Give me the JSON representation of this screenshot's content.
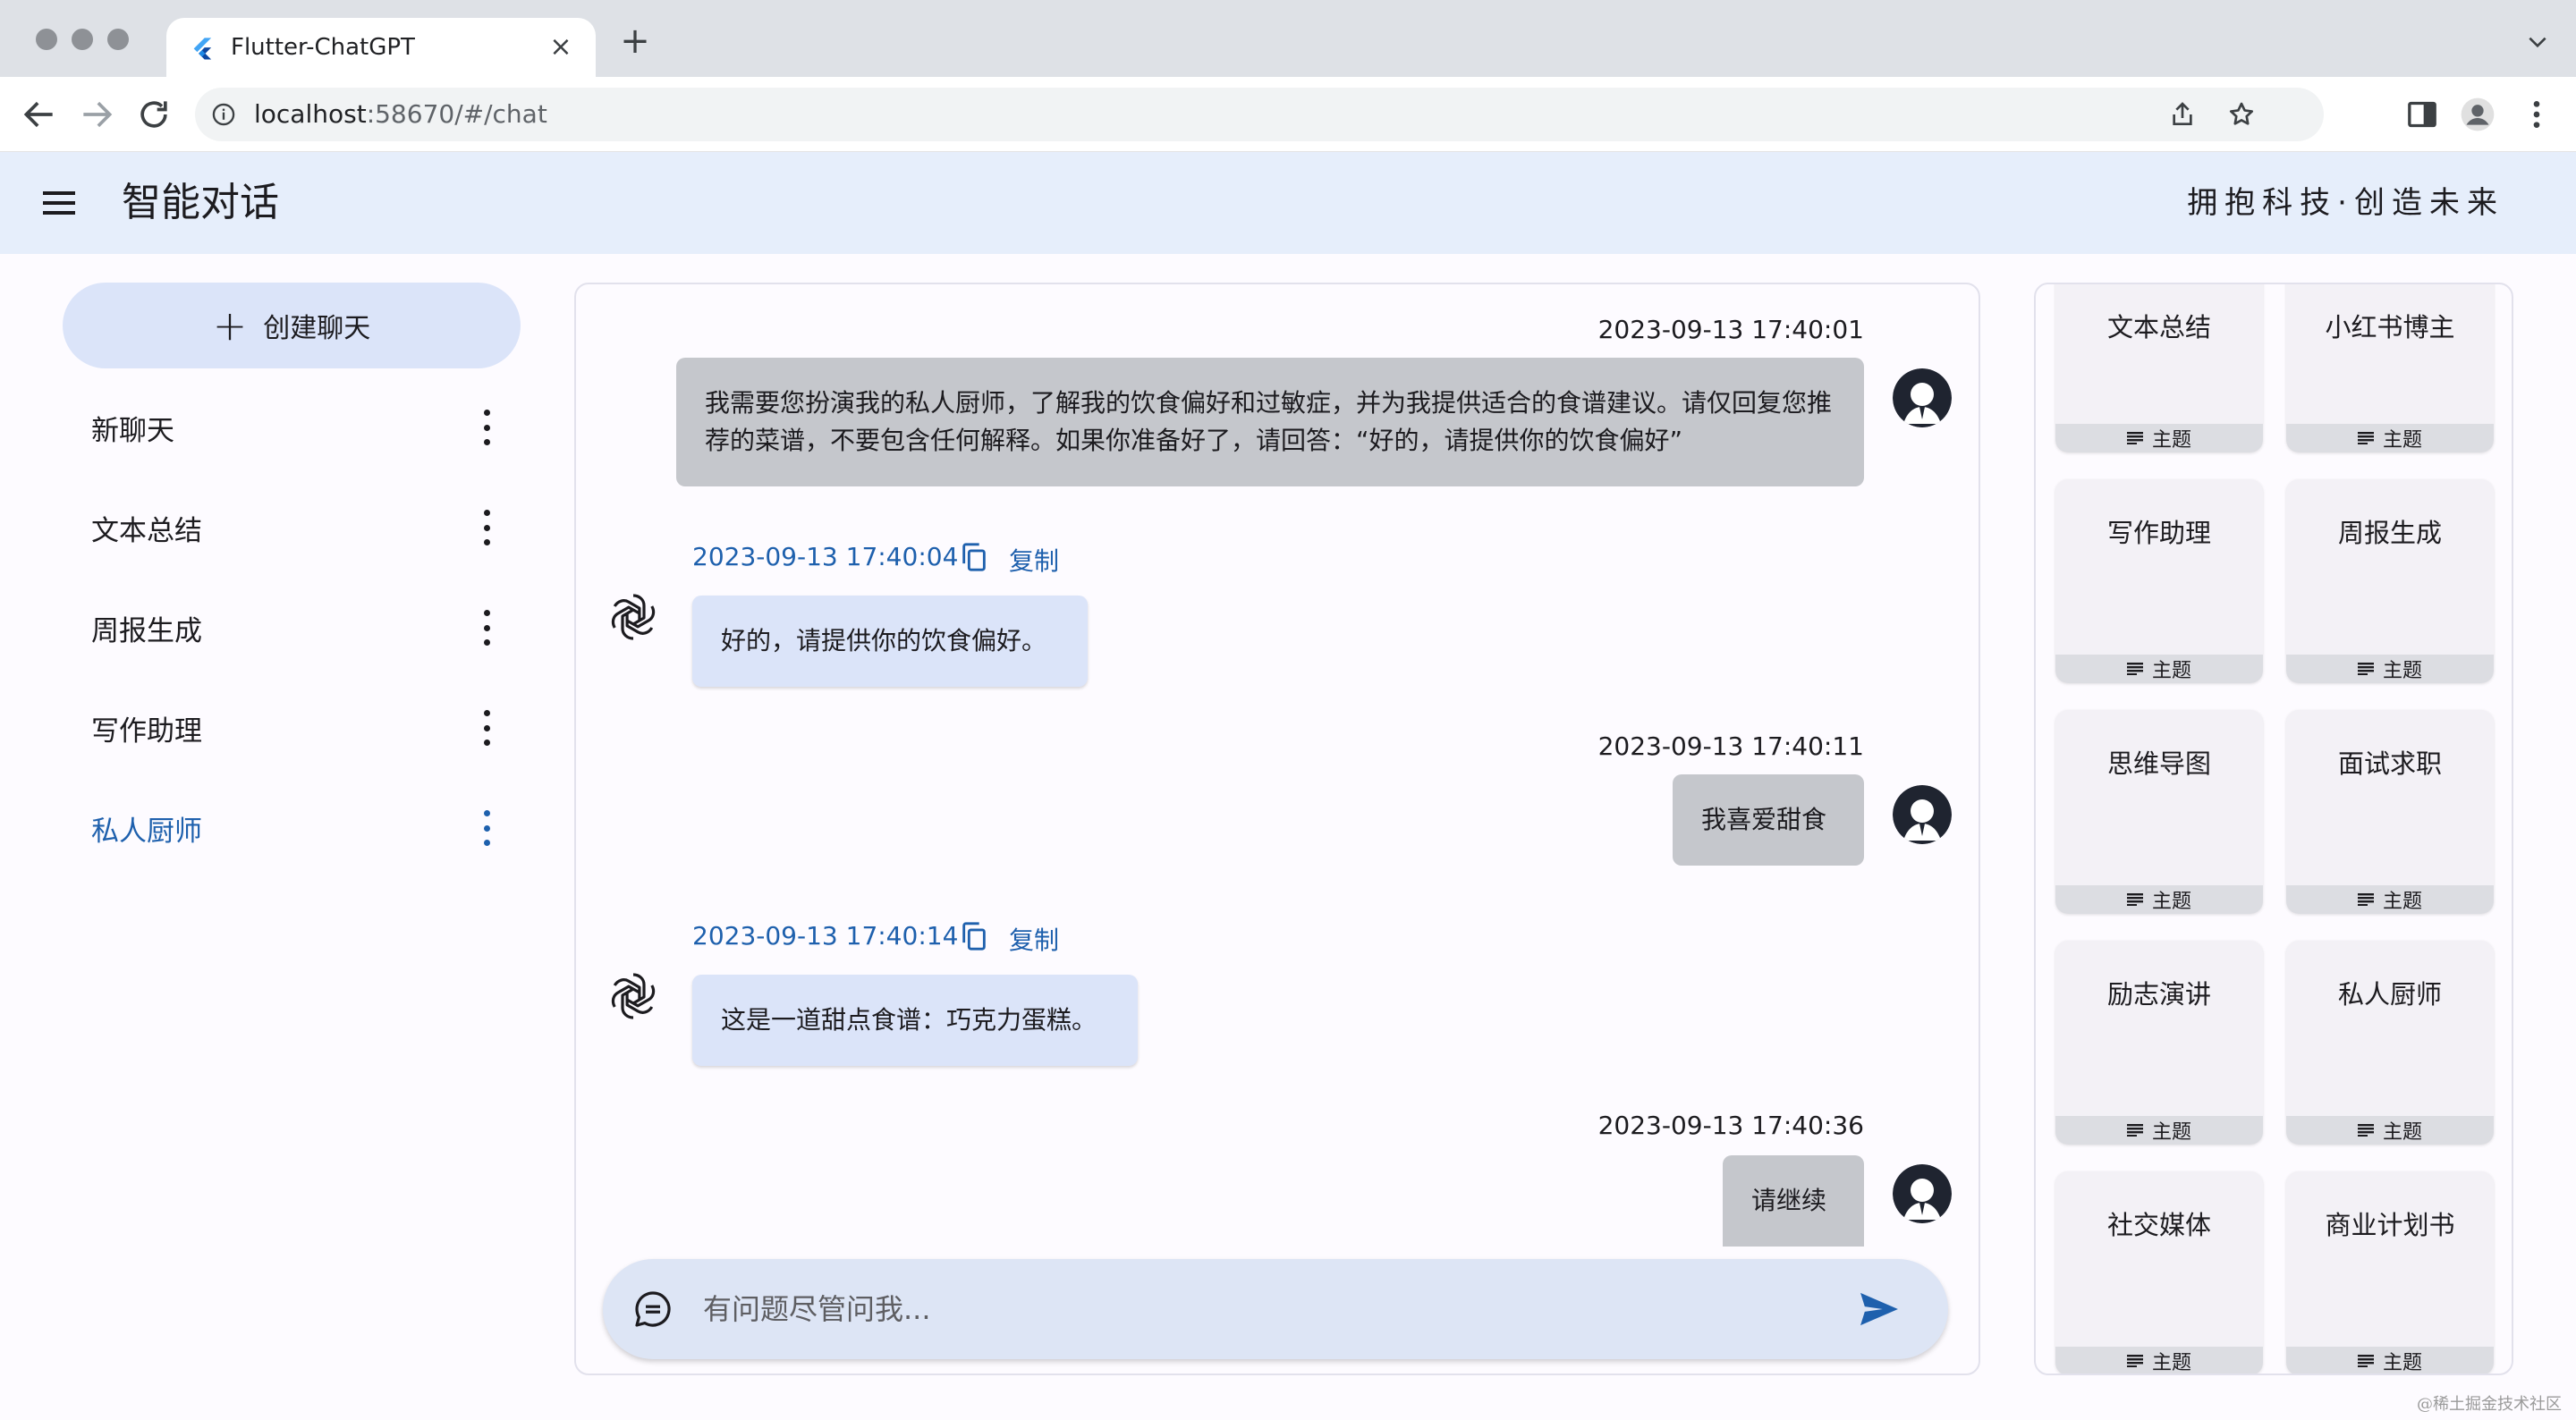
{
  "browser": {
    "tab_title": "Flutter-ChatGPT",
    "url_host": "localhost",
    "url_rest": ":58670/#/chat",
    "icons": [
      "close-icon",
      "plus-icon",
      "chevron-down-icon",
      "back-arrow-icon",
      "forward-arrow-icon",
      "reload-icon",
      "info-icon",
      "share-icon",
      "star-icon",
      "side-panel-icon",
      "profile-icon",
      "more-vert-icon"
    ]
  },
  "header": {
    "title": "智能对话",
    "slogan": "拥抱科技·创造未来"
  },
  "sidebar": {
    "create_label": "创建聊天",
    "items": [
      {
        "label": "新聊天"
      },
      {
        "label": "文本总结"
      },
      {
        "label": "周报生成"
      },
      {
        "label": "写作助理"
      },
      {
        "label": "私人厨师",
        "active": true
      }
    ]
  },
  "chat": {
    "copy_label": "复制",
    "messages": [
      {
        "role": "user",
        "time": "2023-09-13 17:40:01",
        "text": "我需要您扮演我的私人厨师，了解我的饮食偏好和过敏症，并为我提供适合的食谱建议。请仅回复您推荐的菜谱，不要包含任何解释。如果你准备好了，请回答：“好的，请提供你的饮食偏好”"
      },
      {
        "role": "bot",
        "time": "2023-09-13 17:40:04",
        "text": "好的，请提供你的饮食偏好。"
      },
      {
        "role": "user",
        "time": "2023-09-13 17:40:11",
        "text": "我喜爱甜食"
      },
      {
        "role": "bot",
        "time": "2023-09-13 17:40:14",
        "text": "这是一道甜点食谱：巧克力蛋糕。"
      },
      {
        "role": "user",
        "time": "2023-09-13 17:40:36",
        "text": "请继续"
      }
    ],
    "input_placeholder": "有问题尽管问我..."
  },
  "templates": {
    "tag_label": "主题",
    "items": [
      "文本总结",
      "小红书博主",
      "写作助理",
      "周报生成",
      "思维导图",
      "面试求职",
      "励志演讲",
      "私人厨师",
      "社交媒体",
      "商业计划书"
    ]
  },
  "watermark": "@稀土掘金技术社区",
  "colors": {
    "accent": "#1e60ad",
    "appbar_bg": "#e6eefb",
    "bot_bubble": "#dbe4f9",
    "user_bubble": "#c5c7cc"
  }
}
